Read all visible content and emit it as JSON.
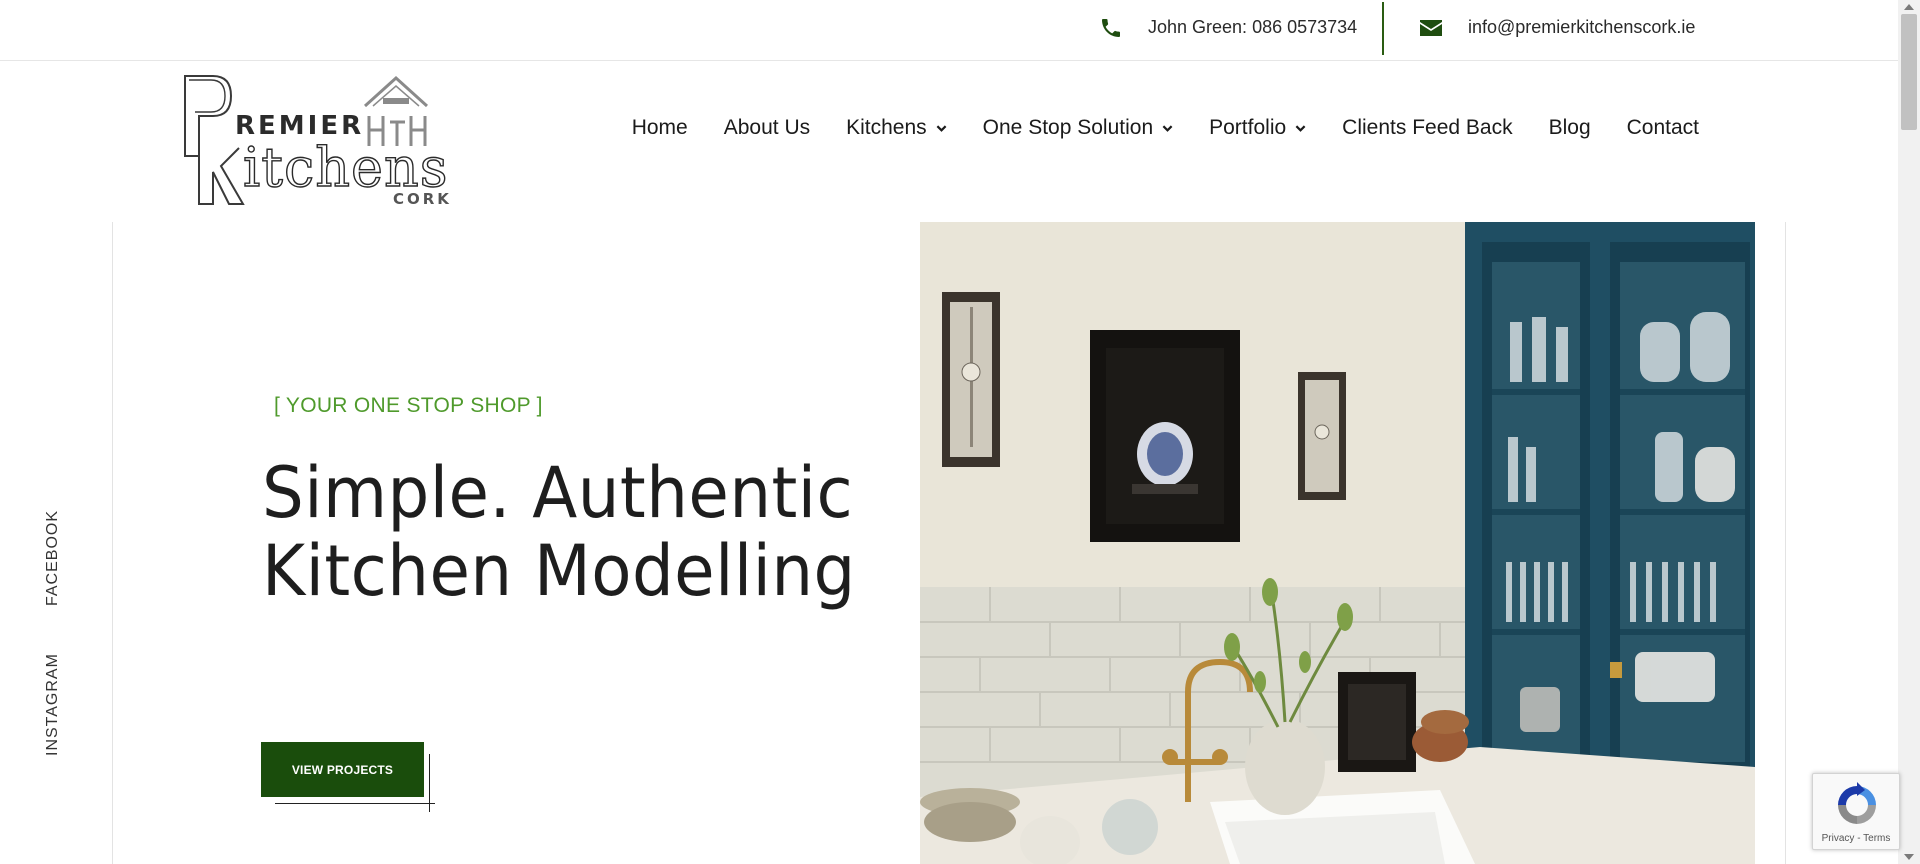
{
  "topbar": {
    "phone_label": "John Green: 086 0573734",
    "email_label": "info@premierkitchenscork.ie"
  },
  "brand": {
    "line1": "REMIER",
    "line2": "itchens",
    "line3": "CORK",
    "initial1": "P",
    "initial2": "K"
  },
  "nav": {
    "items": [
      {
        "label": "Home",
        "has_dropdown": false
      },
      {
        "label": "About Us",
        "has_dropdown": false
      },
      {
        "label": "Kitchens",
        "has_dropdown": true
      },
      {
        "label": "One Stop Solution",
        "has_dropdown": true
      },
      {
        "label": "Portfolio",
        "has_dropdown": true
      },
      {
        "label": "Clients Feed Back",
        "has_dropdown": false
      },
      {
        "label": "Blog",
        "has_dropdown": false
      },
      {
        "label": "Contact",
        "has_dropdown": false
      }
    ]
  },
  "social": {
    "facebook_label": "FACEBOOK",
    "instagram_label": "INSTAGRAM"
  },
  "hero": {
    "eyebrow": "[ YOUR ONE STOP SHOP ]",
    "headline_line1": "Simple. Authentic",
    "headline_line2": "Kitchen Modelling",
    "cta_label": "VIEW PROJECTS"
  },
  "recaptcha": {
    "links": "Privacy - Terms"
  },
  "colors": {
    "brand_green": "#1a4d0c",
    "accent_green": "#4f9a2c",
    "icon_green": "#1f4d10",
    "cabinet_blue": "#1f4e63"
  }
}
